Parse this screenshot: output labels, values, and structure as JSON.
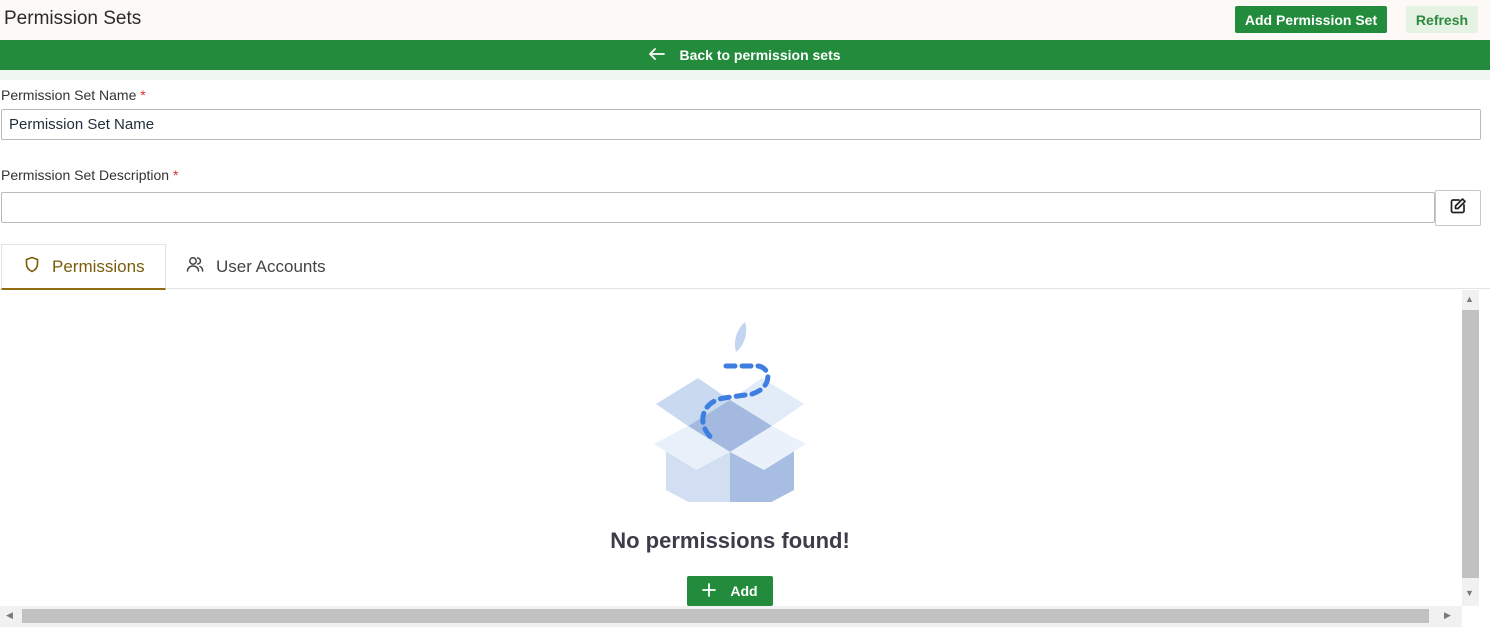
{
  "header": {
    "title": "Permission Sets",
    "add_button_label": "Add Permission Set",
    "refresh_button_label": "Refresh"
  },
  "back_bar": {
    "label": "Back to permission sets",
    "icon": "arrow-left-icon"
  },
  "form": {
    "name_label": "Permission Set Name",
    "name_value": "Permission Set Name",
    "description_label": "Permission Set Description",
    "description_value": "",
    "required_marker": "*",
    "edit_icon": "edit-icon"
  },
  "tabs": [
    {
      "label": "Permissions",
      "icon": "shield-icon",
      "active": true
    },
    {
      "label": "User Accounts",
      "icon": "users-icon",
      "active": false
    }
  ],
  "empty_state": {
    "message": "No permissions found!",
    "add_button_label": "Add",
    "illustration": "empty-box-illustration"
  },
  "colors": {
    "primary_green": "#228b3c",
    "active_tab": "#8f6d0f",
    "required": "#d9302b"
  }
}
